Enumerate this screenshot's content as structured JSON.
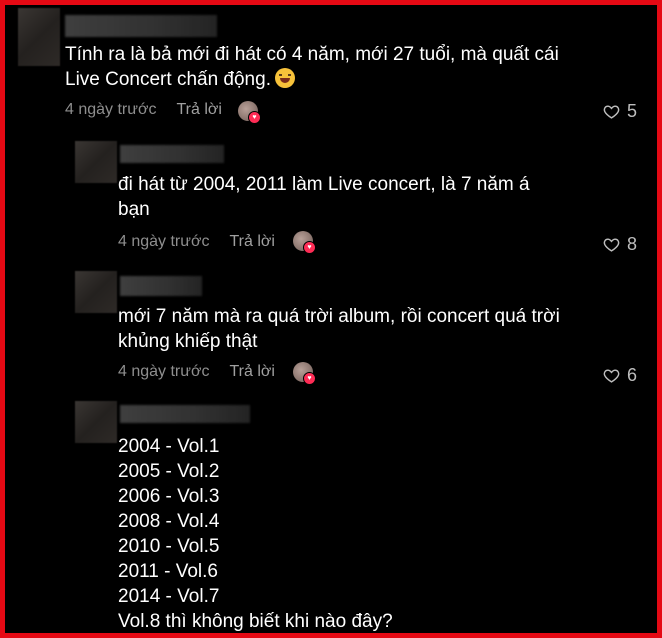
{
  "comments": [
    {
      "text": "Tính ra là bả mới đi hát có 4 năm, mới 27 tuổi, mà quất cái\nLive Concert chấn động.",
      "emoji": "grinning-sweat-emoji",
      "time": "4 ngày trước",
      "reply": "Trả lời",
      "likes": "5"
    },
    {
      "text": "đi hát từ 2004, 2011 làm Live concert, là 7 năm á\nbạn",
      "time": "4 ngày trước",
      "reply": "Trả lời",
      "likes": "8"
    },
    {
      "text": "mới 7 năm mà ra quá trời album, rồi concert quá trời\nkhủng khiếp thật",
      "time": "4 ngày trước",
      "reply": "Trả lời",
      "likes": "6"
    },
    {
      "text": "2004 - Vol.1\n2005 - Vol.2\n2006 - Vol.3\n2008 - Vol.4\n2010 - Vol.5\n2011 - Vol.6\n2014 - Vol.7\nVol.8 thì không biết khi nào đây?"
    }
  ],
  "colors": {
    "border": "#e50914",
    "background": "#000000",
    "meta": "#8e8e8e",
    "heart_badge": "#fe2c55"
  }
}
